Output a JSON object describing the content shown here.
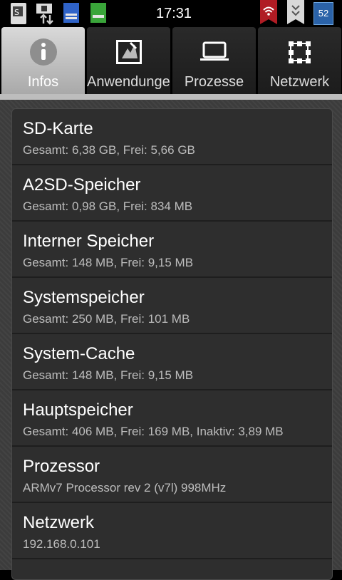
{
  "status_bar": {
    "time": "17:31",
    "battery_level": "52",
    "icons": [
      "sd-card-icon",
      "upload-download-icon",
      "notes-icon",
      "battery-green-icon",
      "wifi-icon",
      "bookmark-icon"
    ]
  },
  "tabs": [
    {
      "label": "Infos",
      "icon": "info-icon",
      "active": true
    },
    {
      "label": "Anwendungen",
      "icon": "apps-icon",
      "active": false
    },
    {
      "label": "Prozesse",
      "icon": "laptop-icon",
      "active": false
    },
    {
      "label": "Netzwerk",
      "icon": "network-icon",
      "active": false
    }
  ],
  "items": [
    {
      "title": "SD-Karte",
      "subtitle": "Gesamt: 6,38 GB, Frei: 5,66 GB"
    },
    {
      "title": "A2SD-Speicher",
      "subtitle": "Gesamt: 0,98 GB, Frei: 834 MB"
    },
    {
      "title": "Interner Speicher",
      "subtitle": "Gesamt: 148 MB, Frei: 9,15 MB"
    },
    {
      "title": "Systemspeicher",
      "subtitle": "Gesamt: 250 MB, Frei: 101 MB"
    },
    {
      "title": "System-Cache",
      "subtitle": "Gesamt: 148 MB, Frei: 9,15 MB"
    },
    {
      "title": "Hauptspeicher",
      "subtitle": "Gesamt: 406 MB, Frei: 169 MB, Inaktiv: 3,89 MB"
    },
    {
      "title": "Prozessor",
      "subtitle": "ARMv7 Processor rev 2 (v7l)  998MHz"
    },
    {
      "title": "Netzwerk",
      "subtitle": "192.168.0.101"
    }
  ],
  "colors": {
    "active_tab": "#c9c9c9",
    "background": "#3c3c3c",
    "panel": "#2e2e2e",
    "battery_green": "#3aa53a"
  }
}
